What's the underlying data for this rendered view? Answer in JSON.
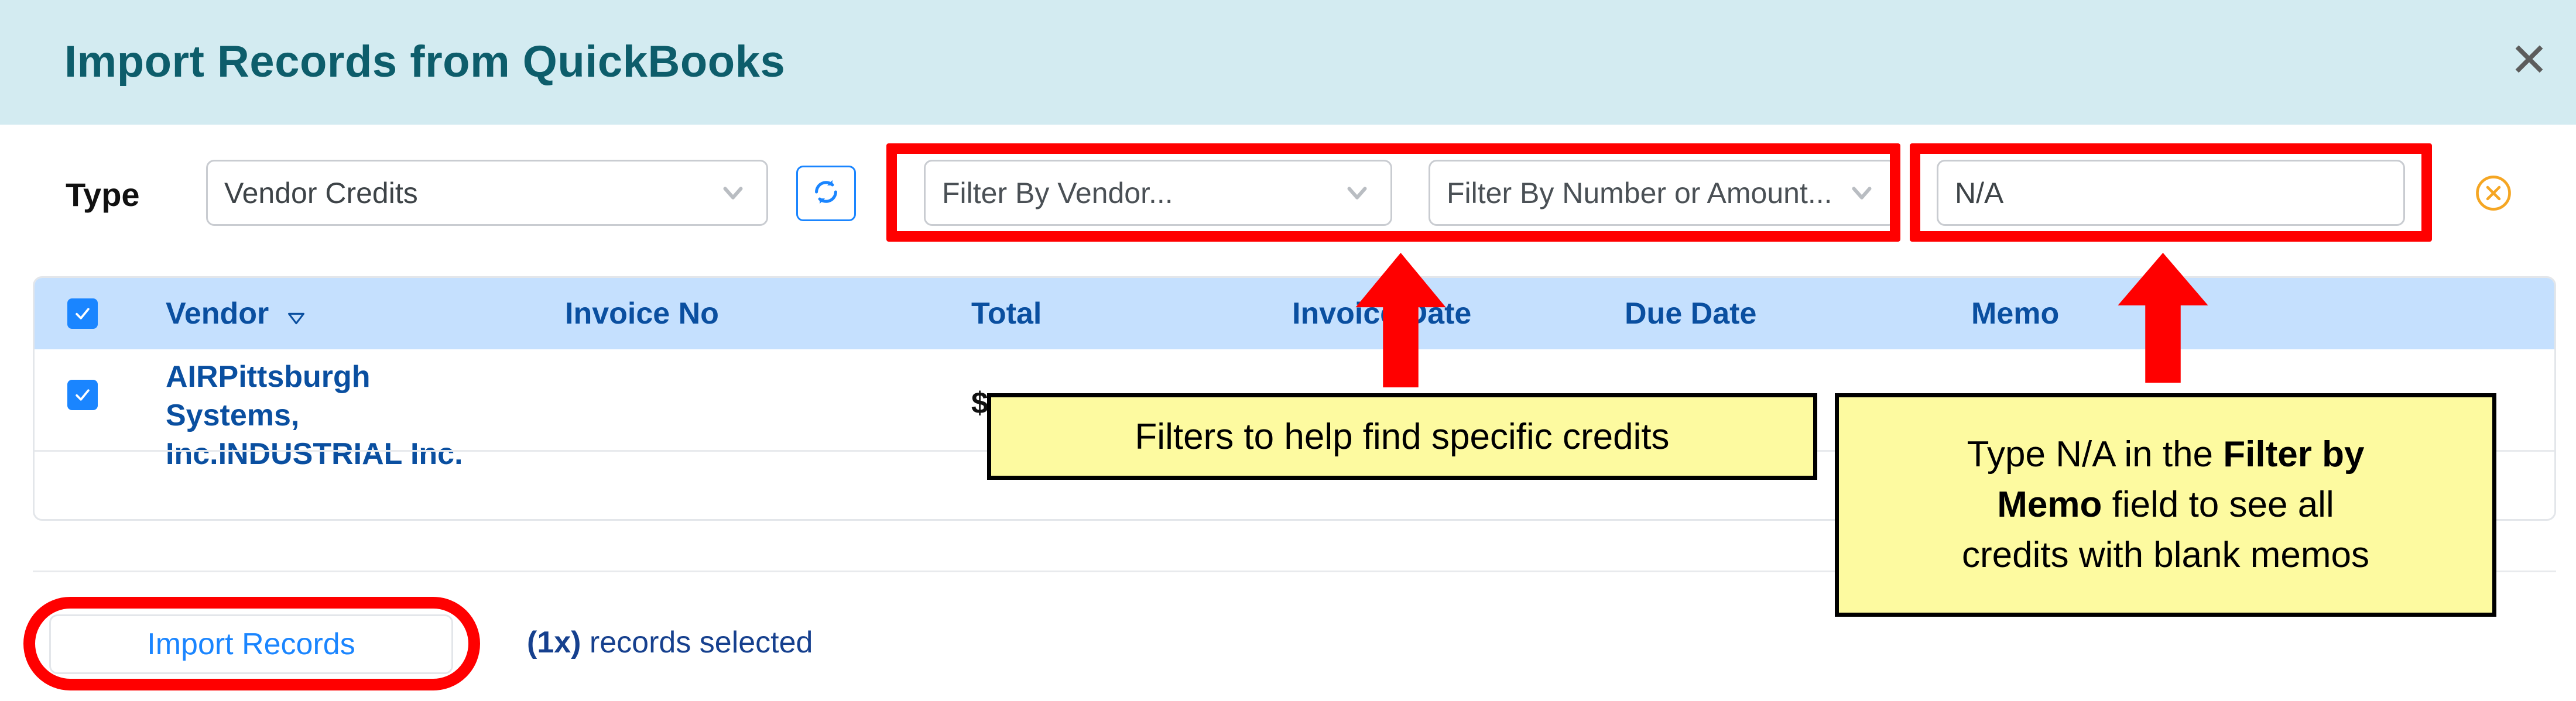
{
  "header": {
    "title": "Import Records from QuickBooks",
    "close_icon": "close-icon",
    "close_glyph": "✕"
  },
  "filter_bar": {
    "type_label": "Type",
    "type_value": "Vendor Credits",
    "refresh_icon": "refresh-icon",
    "vendor_filter_placeholder": "Filter By Vendor...",
    "number_filter_placeholder": "Filter By Number or Amount...",
    "memo_filter_value": "N/A",
    "clear_filters_icon": "clear-filters-icon"
  },
  "table": {
    "select_all_checked": true,
    "columns": [
      {
        "key": "vendor",
        "label": "Vendor",
        "sorted": true,
        "sort_glyph": "▽"
      },
      {
        "key": "invoice_no",
        "label": "Invoice No"
      },
      {
        "key": "total",
        "label": "Total"
      },
      {
        "key": "invoice_date",
        "label": "Invoice Date"
      },
      {
        "key": "due_date",
        "label": "Due Date"
      },
      {
        "key": "memo",
        "label": "Memo"
      }
    ],
    "rows": [
      {
        "selected": true,
        "vendor": "AIRPittsburgh\nSystems,\nInc.INDUSTRIAL Inc.",
        "invoice_no": "",
        "total": "$",
        "invoice_date": "",
        "due_date": "",
        "memo": ""
      }
    ]
  },
  "footer": {
    "import_button_label": "Import Records",
    "records_selected_count": "(1x)",
    "records_selected_suffix": " records selected"
  },
  "annotations": {
    "callout_filters": "Filters to help find specific credits",
    "callout_memo_line1": "Type N/A in the ",
    "callout_memo_bold1": "Filter by",
    "callout_memo_bold2": "Memo",
    "callout_memo_line2": " field to see all",
    "callout_memo_line3": "credits with blank memos",
    "highlight_color": "#ff0000",
    "callout_bg": "#fdfaa0"
  },
  "colors": {
    "header_bg": "#d3ebf1",
    "header_text": "#0d5d6b",
    "table_header_bg": "#c5e0fe",
    "table_header_text": "#0a4fa0",
    "accent_blue": "#1a85ff",
    "clear_orange": "#f5a623"
  }
}
